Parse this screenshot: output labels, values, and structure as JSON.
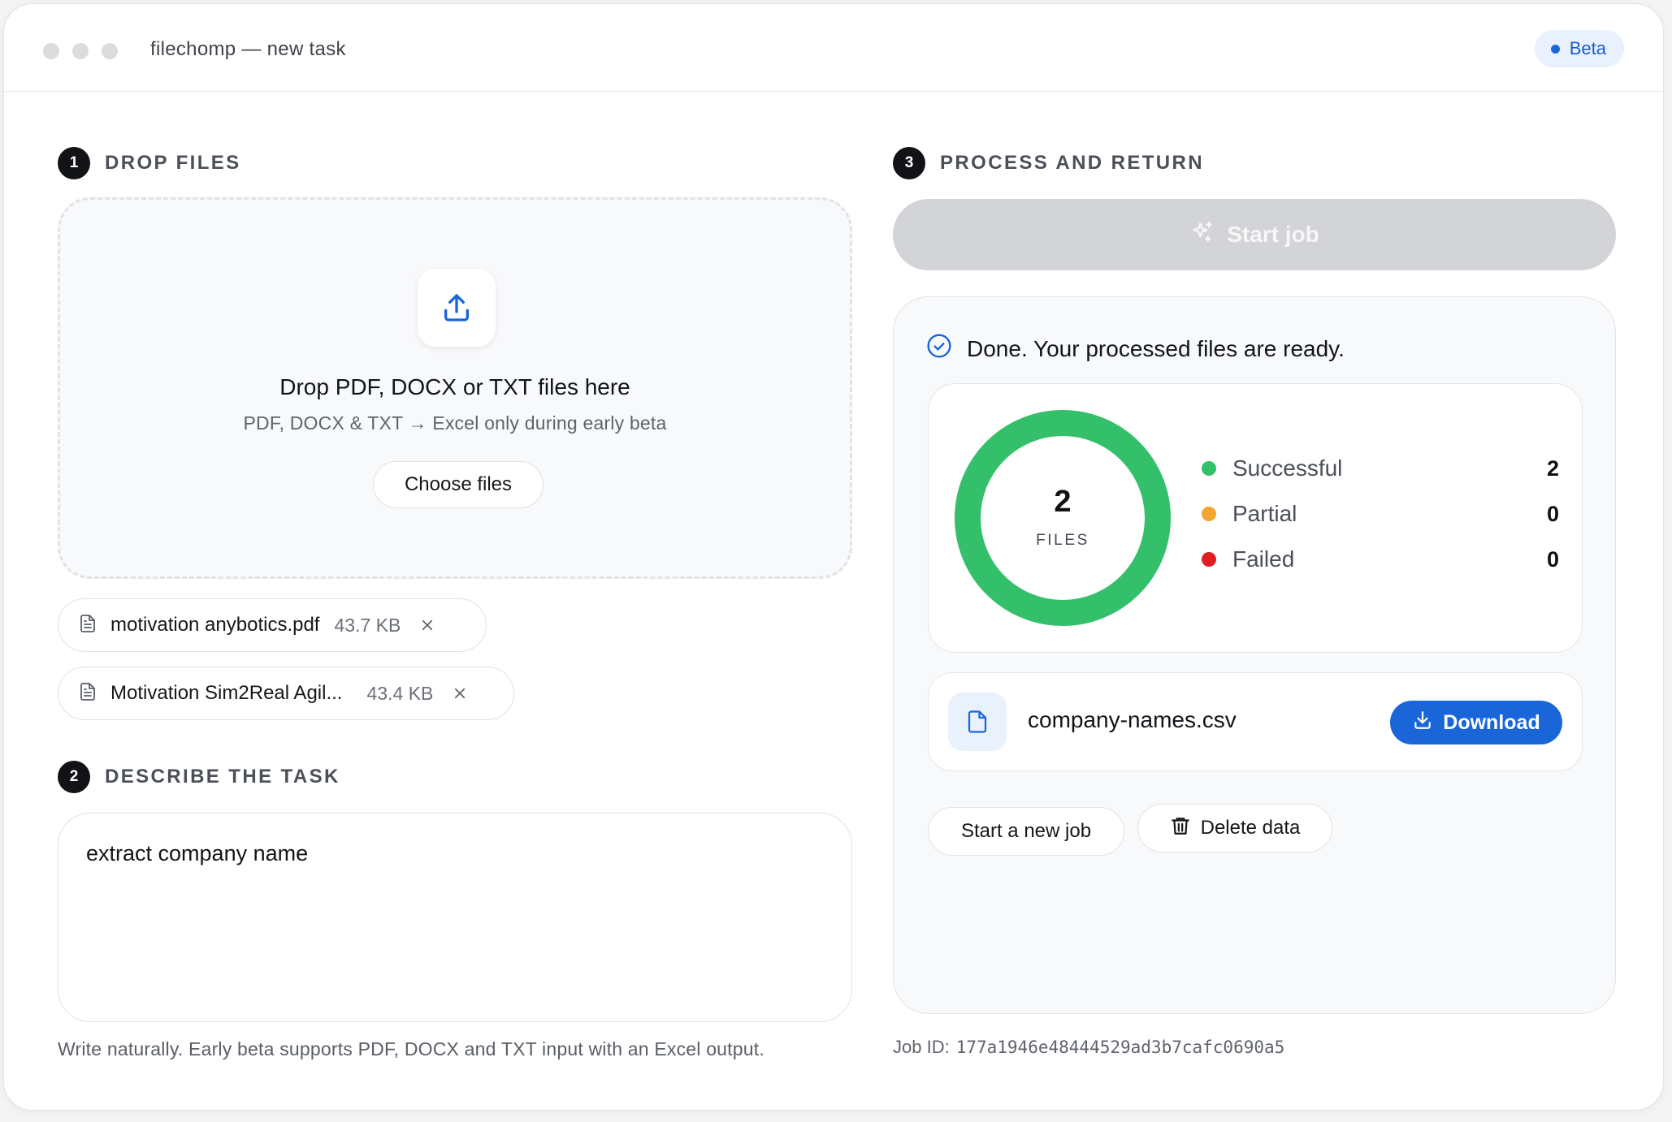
{
  "window": {
    "title": "filechomp — new task",
    "badge": "Beta"
  },
  "colors": {
    "accent": "#1a66d9",
    "success": "#34c06a",
    "partial": "#f2a531",
    "failed": "#e11d21",
    "disabled_button": "#d3d4d7"
  },
  "step1": {
    "number": "1",
    "label": "DROP FILES",
    "icon": "upload-icon",
    "dropzone_title": "Drop PDF, DOCX or TXT files here",
    "dropzone_subtitle": "PDF, DOCX & TXT → Excel only during early beta",
    "choose_button": "Choose files",
    "files": [
      {
        "name": "motivation anybotics.pdf",
        "size": "43.7 KB",
        "icon": "document-icon"
      },
      {
        "name": "Motivation Sim2Real Agil...",
        "size": "43.4 KB",
        "icon": "document-icon"
      }
    ]
  },
  "step2": {
    "number": "2",
    "label": "DESCRIBE THE TASK",
    "task_text": "extract company name",
    "hint": "Write naturally. Early beta supports PDF, DOCX and TXT input with an Excel output."
  },
  "step3": {
    "number": "3",
    "label": "PROCESS AND RETURN",
    "start_button": "Start job",
    "status": "Done. Your processed files are ready.",
    "summary": {
      "total": "2",
      "total_label": "FILES",
      "items": [
        {
          "label": "Successful",
          "value": "2",
          "color": "#34c06a"
        },
        {
          "label": "Partial",
          "value": "0",
          "color": "#f2a531"
        },
        {
          "label": "Failed",
          "value": "0",
          "color": "#e11d21"
        }
      ]
    },
    "output_file": {
      "name": "company-names.csv",
      "download_label": "Download"
    },
    "new_job_button": "Start a new job",
    "delete_button": "Delete data",
    "job_id_label": "Job ID:",
    "job_id": "177a1946e48444529ad3b7cafc0690a5"
  }
}
